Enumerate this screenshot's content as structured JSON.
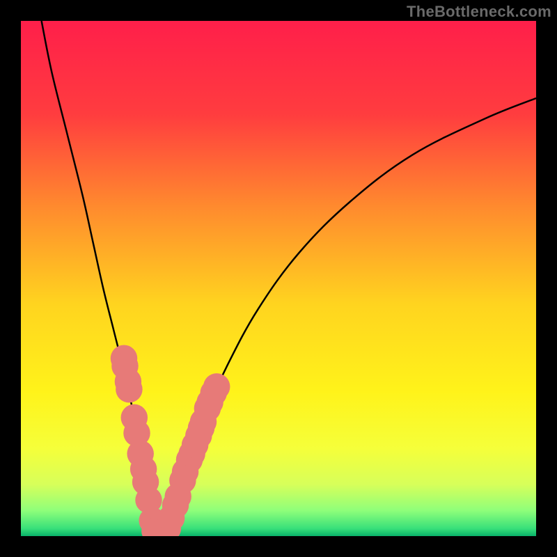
{
  "attribution": "TheBottleneck.com",
  "colors": {
    "gradient_stops": [
      {
        "offset": 0.0,
        "color": "#ff1f4a"
      },
      {
        "offset": 0.18,
        "color": "#ff3c3f"
      },
      {
        "offset": 0.36,
        "color": "#ff8a2e"
      },
      {
        "offset": 0.55,
        "color": "#ffd41f"
      },
      {
        "offset": 0.72,
        "color": "#fff31a"
      },
      {
        "offset": 0.83,
        "color": "#f5ff3a"
      },
      {
        "offset": 0.9,
        "color": "#d7ff5a"
      },
      {
        "offset": 0.95,
        "color": "#8fff7a"
      },
      {
        "offset": 0.985,
        "color": "#39e07a"
      },
      {
        "offset": 1.0,
        "color": "#09b36a"
      }
    ],
    "marker": "#e77a78",
    "curve": "#000000",
    "frame": "#000000"
  },
  "chart_data": {
    "type": "line",
    "title": "",
    "xlabel": "",
    "ylabel": "",
    "xlim": [
      0,
      100
    ],
    "ylim": [
      0,
      100
    ],
    "grid": false,
    "legend": false,
    "series": [
      {
        "name": "bottleneck-curve",
        "x": [
          4,
          6,
          9,
          12,
          14,
          16,
          18,
          20,
          22,
          23.5,
          25,
          26.5,
          28,
          30,
          33,
          36,
          40,
          46,
          54,
          64,
          76,
          90,
          100
        ],
        "y": [
          100,
          90,
          78,
          66,
          57,
          48,
          40,
          32,
          23,
          14,
          5,
          0,
          0,
          6,
          15,
          24,
          33,
          44,
          55,
          65,
          74,
          81,
          85
        ]
      }
    ],
    "markers": [
      {
        "x": 20.0,
        "y": 34.5,
        "r": 2.6
      },
      {
        "x": 20.2,
        "y": 33.0,
        "r": 2.6
      },
      {
        "x": 20.8,
        "y": 30.0,
        "r": 2.6
      },
      {
        "x": 21.0,
        "y": 28.5,
        "r": 2.6
      },
      {
        "x": 22.0,
        "y": 23.0,
        "r": 2.6
      },
      {
        "x": 22.5,
        "y": 20.0,
        "r": 2.6
      },
      {
        "x": 23.2,
        "y": 16.0,
        "r": 2.6
      },
      {
        "x": 23.8,
        "y": 13.0,
        "r": 2.6
      },
      {
        "x": 24.2,
        "y": 10.5,
        "r": 2.6
      },
      {
        "x": 24.8,
        "y": 7.0,
        "r": 2.6
      },
      {
        "x": 25.5,
        "y": 3.0,
        "r": 2.6
      },
      {
        "x": 26.0,
        "y": 1.0,
        "r": 2.6
      },
      {
        "x": 26.7,
        "y": 0.3,
        "r": 2.6
      },
      {
        "x": 27.6,
        "y": 0.3,
        "r": 2.6
      },
      {
        "x": 28.5,
        "y": 1.5,
        "r": 2.6
      },
      {
        "x": 29.2,
        "y": 3.5,
        "r": 2.6
      },
      {
        "x": 30.0,
        "y": 6.0,
        "r": 2.6
      },
      {
        "x": 30.5,
        "y": 7.7,
        "r": 2.6
      },
      {
        "x": 31.4,
        "y": 10.8,
        "r": 2.6
      },
      {
        "x": 31.9,
        "y": 12.5,
        "r": 2.6
      },
      {
        "x": 32.7,
        "y": 14.8,
        "r": 2.6
      },
      {
        "x": 33.2,
        "y": 16.0,
        "r": 2.6
      },
      {
        "x": 33.8,
        "y": 17.7,
        "r": 2.6
      },
      {
        "x": 34.5,
        "y": 19.5,
        "r": 2.6
      },
      {
        "x": 35.0,
        "y": 21.0,
        "r": 2.6
      },
      {
        "x": 35.4,
        "y": 22.2,
        "r": 2.6
      },
      {
        "x": 36.2,
        "y": 24.8,
        "r": 2.6
      },
      {
        "x": 36.7,
        "y": 26.0,
        "r": 2.6
      },
      {
        "x": 37.4,
        "y": 27.8,
        "r": 2.6
      },
      {
        "x": 38.0,
        "y": 29.0,
        "r": 2.6
      }
    ]
  }
}
